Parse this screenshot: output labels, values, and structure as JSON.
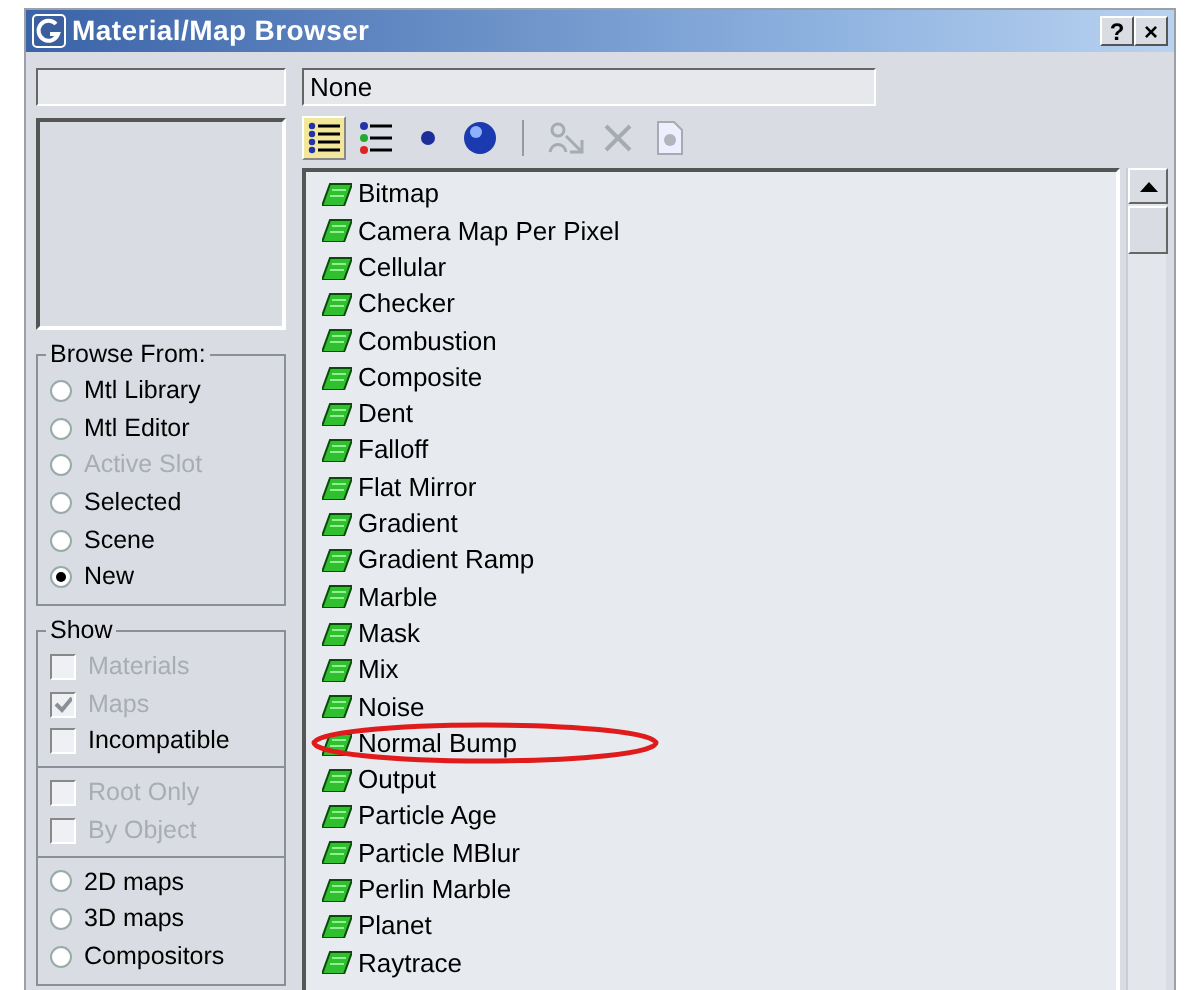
{
  "window": {
    "title": "Material/Map Browser",
    "buttons": [
      "?",
      "×"
    ]
  },
  "name_field": {
    "value": "None"
  },
  "view_buttons": [
    {
      "kind": "list",
      "selected": true
    },
    {
      "kind": "list-icons",
      "selected": false
    },
    {
      "kind": "small-icons",
      "selected": false
    },
    {
      "kind": "large-icons",
      "selected": false
    }
  ],
  "action_buttons": [
    {
      "kind": "update",
      "disabled": true
    },
    {
      "kind": "delete",
      "disabled": true
    },
    {
      "kind": "new",
      "disabled": true
    }
  ],
  "browse_from": {
    "title": "Browse From:",
    "options": [
      {
        "label": "Mtl Library",
        "selected": false,
        "disabled": false
      },
      {
        "label": "Mtl Editor",
        "selected": false,
        "disabled": false
      },
      {
        "label": "Active Slot",
        "selected": false,
        "disabled": true
      },
      {
        "label": "Selected",
        "selected": false,
        "disabled": false
      },
      {
        "label": "Scene",
        "selected": false,
        "disabled": false
      },
      {
        "label": "New",
        "selected": true,
        "disabled": false
      }
    ]
  },
  "show": {
    "title": "Show",
    "groups": [
      [
        {
          "kind": "checkbox",
          "label": "Materials",
          "checked": false,
          "disabled": true
        },
        {
          "kind": "checkbox",
          "label": "Maps",
          "checked": true,
          "disabled": true
        },
        {
          "kind": "checkbox",
          "label": "Incompatible",
          "checked": false,
          "disabled": false
        }
      ],
      [
        {
          "kind": "checkbox",
          "label": "Root Only",
          "checked": false,
          "disabled": true
        },
        {
          "kind": "checkbox",
          "label": "By Object",
          "checked": false,
          "disabled": true
        }
      ],
      [
        {
          "kind": "radio",
          "label": "2D maps",
          "checked": false,
          "disabled": false
        },
        {
          "kind": "radio",
          "label": "3D maps",
          "checked": false,
          "disabled": false
        },
        {
          "kind": "radio",
          "label": "Compositors",
          "checked": false,
          "disabled": false
        }
      ]
    ]
  },
  "maps": [
    {
      "label": "Bitmap",
      "circled": false
    },
    {
      "label": "Camera Map Per Pixel",
      "circled": false
    },
    {
      "label": "Cellular",
      "circled": false
    },
    {
      "label": "Checker",
      "circled": false
    },
    {
      "label": "Combustion",
      "circled": false
    },
    {
      "label": "Composite",
      "circled": false
    },
    {
      "label": "Dent",
      "circled": false
    },
    {
      "label": "Falloff",
      "circled": false
    },
    {
      "label": "Flat Mirror",
      "circled": false
    },
    {
      "label": "Gradient",
      "circled": false
    },
    {
      "label": "Gradient Ramp",
      "circled": false
    },
    {
      "label": "Marble",
      "circled": false
    },
    {
      "label": "Mask",
      "circled": false
    },
    {
      "label": "Mix",
      "circled": false
    },
    {
      "label": "Noise",
      "circled": false
    },
    {
      "label": "Normal Bump",
      "circled": true
    },
    {
      "label": "Output",
      "circled": false
    },
    {
      "label": "Particle Age",
      "circled": false
    },
    {
      "label": "Particle MBlur",
      "circled": false
    },
    {
      "label": "Perlin Marble",
      "circled": false
    },
    {
      "label": "Planet",
      "circled": false
    },
    {
      "label": "Raytrace",
      "circled": false
    }
  ]
}
